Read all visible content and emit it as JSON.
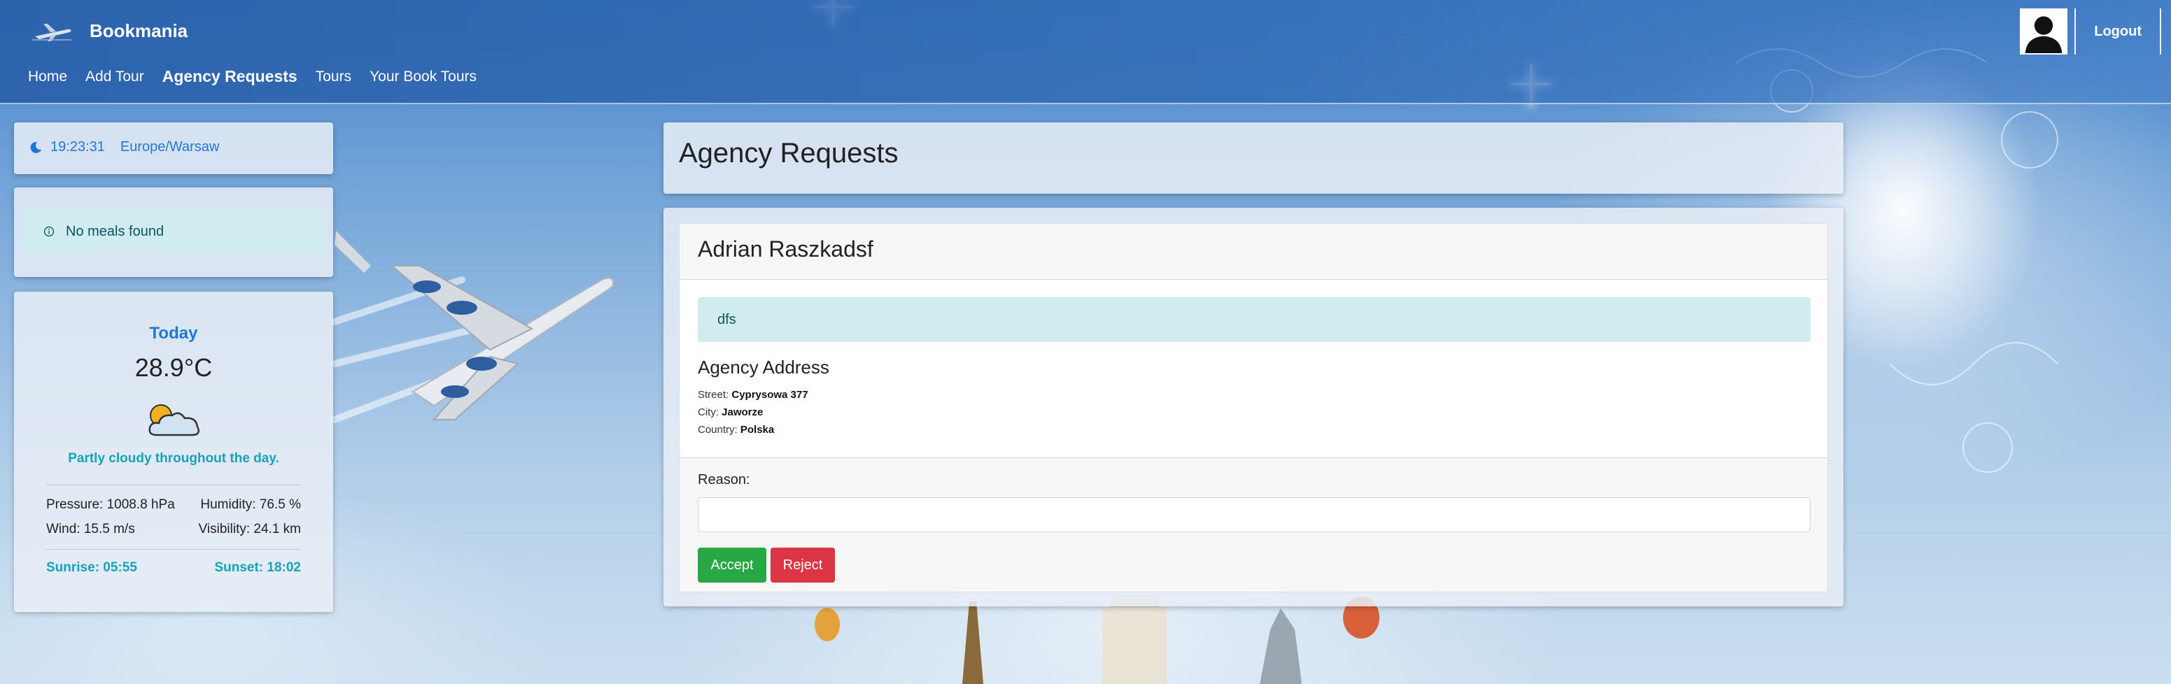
{
  "navbar": {
    "brand": "Bookmania",
    "links": [
      "Home",
      "Add Tour",
      "Agency Requests",
      "Tours",
      "Your Book Tours"
    ],
    "logout": "Logout"
  },
  "sidebar": {
    "clock": {
      "time": "19:23:31",
      "timezone": "Europe/Warsaw"
    },
    "meals": {
      "message": "No meals found"
    },
    "weather": {
      "heading": "Today",
      "temperature": "28.9°C",
      "icon": "partly-cloudy-icon",
      "description": "Partly cloudy throughout the day.",
      "pressure": "Pressure: 1008.8 hPa",
      "humidity": "Humidity: 76.5 %",
      "wind": "Wind: 15.5 m/s",
      "visibility": "Visibility: 24.1 km",
      "sunrise": "Sunrise: 05:55",
      "sunset": "Sunset: 18:02"
    }
  },
  "main": {
    "title": "Agency Requests",
    "request": {
      "name": "Adrian Raszkadsf",
      "message": "dfs",
      "address_title": "Agency Address",
      "street_label": "Street:",
      "street": "Cyprysowa 377",
      "city_label": "City:",
      "city": "Jaworze",
      "country_label": "Country:",
      "country": "Polska",
      "reason_label": "Reason:",
      "reason_value": "",
      "accept_label": "Accept",
      "reject_label": "Reject"
    }
  },
  "colors": {
    "accent": "#1f78d8",
    "info": "#17a2b8",
    "success": "#28a745",
    "danger": "#dc3545"
  }
}
